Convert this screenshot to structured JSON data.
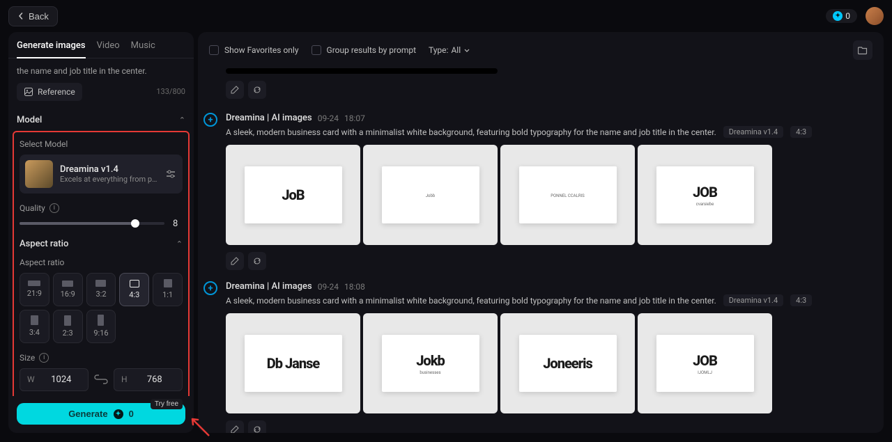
{
  "topbar": {
    "back": "Back",
    "credits": "0"
  },
  "tabs": {
    "generate_images": "Generate images",
    "video": "Video",
    "music": "Music"
  },
  "prompt": {
    "preview": "the name and job title in the center.",
    "reference": "Reference",
    "char_count": "133/800"
  },
  "model": {
    "section": "Model",
    "select_label": "Select Model",
    "name": "Dreamina v1.4",
    "desc": "Excels at everything from photoreali..."
  },
  "quality": {
    "label": "Quality",
    "value": "8"
  },
  "aspect": {
    "section": "Aspect ratio",
    "label": "Aspect ratio",
    "ratios": [
      "21:9",
      "16:9",
      "3:2",
      "4:3",
      "1:1",
      "3:4",
      "2:3",
      "9:16"
    ]
  },
  "size": {
    "label": "Size",
    "w_label": "W",
    "w": "1024",
    "h_label": "H",
    "h": "768"
  },
  "generate": {
    "label": "Generate",
    "cost": "0",
    "try_free": "Try free"
  },
  "content_header": {
    "favorites": "Show Favorites only",
    "group": "Group results by prompt",
    "type_label": "Type:",
    "type_value": "All"
  },
  "results": [
    {
      "name": "Dreamina | AI images",
      "date": "09-24",
      "time": "18:07",
      "prompt": "A sleek, modern business card with a minimalist white background, featuring bold typography for the name and job title in the center.",
      "model": "Dreamina v1.4",
      "ratio": "4:3",
      "cards": [
        {
          "big": "JoB",
          "sub": "",
          "tiny": ""
        },
        {
          "big": "",
          "sub": "Jobb",
          "tiny": ""
        },
        {
          "big": "",
          "sub": "PONNEL CCALRIS",
          "tiny": ""
        },
        {
          "big": "JOB",
          "sub": "cvarsiebe",
          "tiny": ""
        }
      ]
    },
    {
      "name": "Dreamina | AI images",
      "date": "09-24",
      "time": "18:08",
      "prompt": "A sleek, modern business card with a minimalist white background, featuring bold typography for the name and job title in the center.",
      "model": "Dreamina v1.4",
      "ratio": "4:3",
      "cards": [
        {
          "big": "Db Janse",
          "sub": "",
          "tiny": ""
        },
        {
          "big": "Jokb",
          "sub": "businesses",
          "tiny": ""
        },
        {
          "big": "Joneeris",
          "sub": "",
          "tiny": ""
        },
        {
          "big": "JOB",
          "sub": "IJOMLJ",
          "tiny": ""
        }
      ]
    }
  ]
}
